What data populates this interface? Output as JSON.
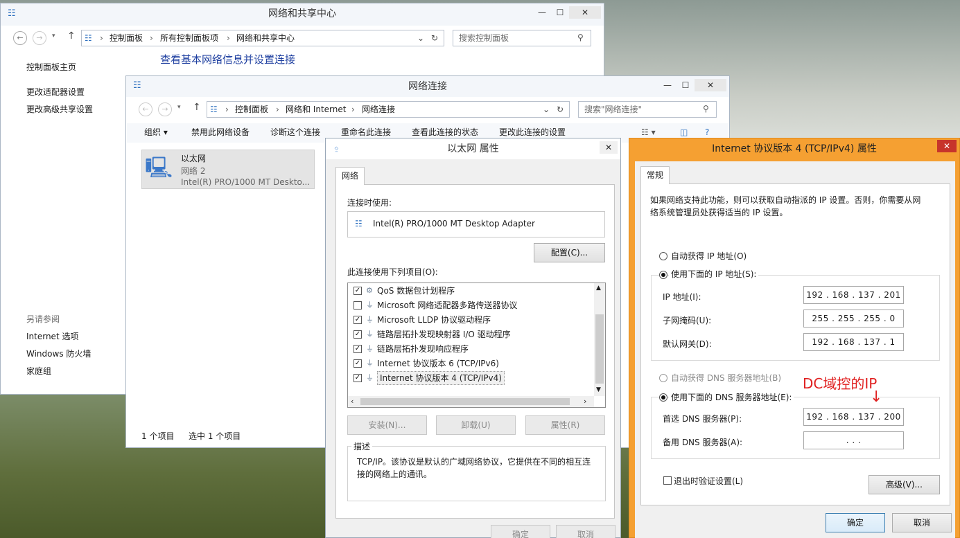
{
  "desktop": {
    "annotation": "DC域控的IP",
    "annotation_color": "#e02020"
  },
  "nsc": {
    "title": "网络和共享中心",
    "breadcrumbs": [
      "控制面板",
      "所有控制面板项",
      "网络和共享中心"
    ],
    "search_placeholder": "搜索控制面板",
    "heading": "查看基本网络信息并设置连接",
    "sidebar": {
      "home": "控制面板主页",
      "links": [
        "更改适配器设置",
        "更改高级共享设置"
      ],
      "see_also_label": "另请参阅",
      "see_also": [
        "Internet 选项",
        "Windows 防火墙",
        "家庭组"
      ]
    }
  },
  "netconn": {
    "title": "网络连接",
    "breadcrumbs": [
      "控制面板",
      "网络和 Internet",
      "网络连接"
    ],
    "search_placeholder": "搜索\"网络连接\"",
    "toolbar": [
      "组织 ▾",
      "禁用此网络设备",
      "诊断这个连接",
      "重命名此连接",
      "查看此连接的状态",
      "更改此连接的设置"
    ],
    "adapter": {
      "name": "以太网",
      "network": "网络  2",
      "device": "Intel(R) PRO/1000 MT Deskto..."
    },
    "status": {
      "count": "1 个项目",
      "selected": "选中 1 个项目"
    }
  },
  "ethprops": {
    "title": "以太网 属性",
    "tab": "网络",
    "connect_using_label": "连接时使用:",
    "adapter": "Intel(R) PRO/1000 MT Desktop Adapter",
    "configure": "配置(C)...",
    "items_label": "此连接使用下列项目(O):",
    "items": [
      {
        "label": "QoS 数据包计划程序",
        "checked": "✓"
      },
      {
        "label": "Microsoft 网络适配器多路传送器协议",
        "checked": ""
      },
      {
        "label": "Microsoft LLDP 协议驱动程序",
        "checked": "✓"
      },
      {
        "label": "链路层拓扑发现映射器 I/O 驱动程序",
        "checked": "✓"
      },
      {
        "label": "链路层拓扑发现响应程序",
        "checked": "✓"
      },
      {
        "label": "Internet 协议版本 6 (TCP/IPv6)",
        "checked": "✓"
      },
      {
        "label": "Internet 协议版本 4 (TCP/IPv4)",
        "checked": "✓"
      }
    ],
    "install": "安装(N)...",
    "uninstall": "卸载(U)",
    "properties": "属性(R)",
    "desc_label": "描述",
    "description": "TCP/IP。该协议是默认的广域网络协议，它提供在不同的相互连接的网络上的通讯。",
    "ok": "确定",
    "cancel": "取消"
  },
  "ipv4": {
    "title": "Internet 协议版本 4 (TCP/IPv4) 属性",
    "tab": "常规",
    "intro": "如果网络支持此功能，则可以获取自动指派的 IP 设置。否则，你需要从网络系统管理员处获得适当的 IP 设置。",
    "auto_ip": "自动获得 IP 地址(O)",
    "use_ip": "使用下面的 IP 地址(S):",
    "ip_label": "IP 地址(I):",
    "ip_value": "192 . 168 . 137 . 201",
    "mask_label": "子网掩码(U):",
    "mask_value": "255 . 255 . 255 .  0",
    "gw_label": "默认网关(D):",
    "gw_value": "192 . 168 . 137 .  1",
    "auto_dns": "自动获得 DNS 服务器地址(B)",
    "use_dns": "使用下面的 DNS 服务器地址(E):",
    "dns1_label": "首选 DNS 服务器(P):",
    "dns1_value": "192 . 168 . 137 . 200",
    "dns2_label": "备用 DNS 服务器(A):",
    "dns2_value": ".       .       .",
    "validate": "退出时验证设置(L)",
    "advanced": "高级(V)...",
    "ok": "确定",
    "cancel": "取消",
    "accent": "#f5a032"
  }
}
